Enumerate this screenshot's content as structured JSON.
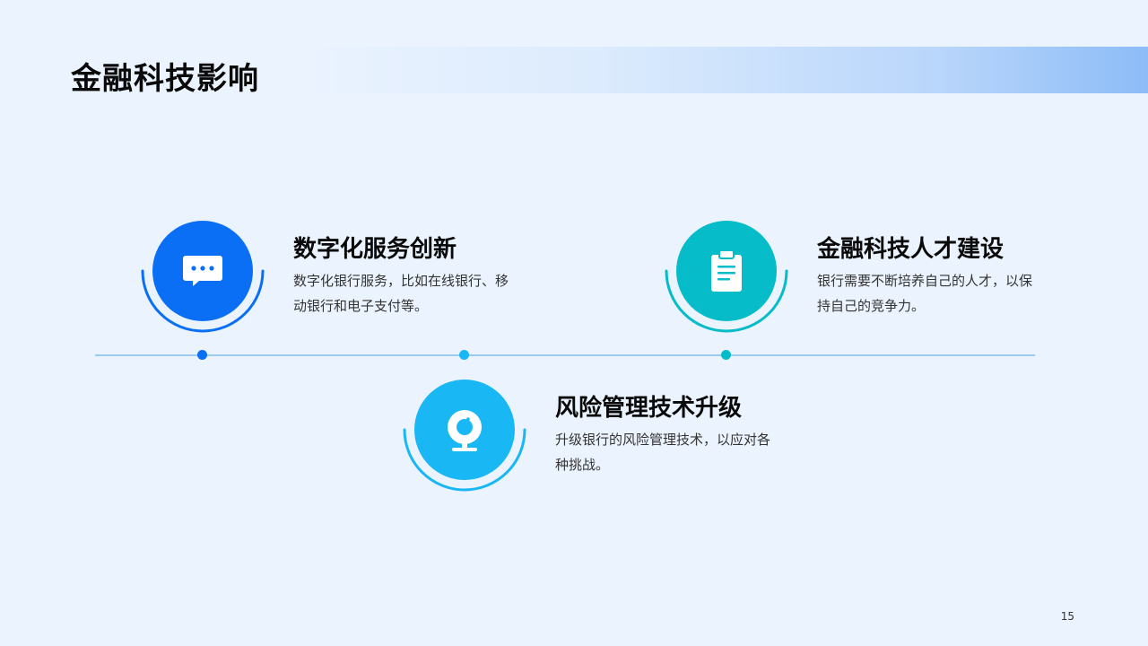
{
  "slide": {
    "title": "金融科技影响",
    "page_number": "15"
  },
  "items": [
    {
      "heading": "数字化服务创新",
      "description": "数字化银行服务，比如在线银行、移动银行和电子支付等。",
      "icon": "chat-bubble-icon",
      "color": "#0b6ff5"
    },
    {
      "heading": "风险管理技术升级",
      "description": "升级银行的风险管理技术，以应对各种挑战。",
      "icon": "webcam-icon",
      "color": "#1ab7f5"
    },
    {
      "heading": "金融科技人才建设",
      "description": "银行需要不断培养自己的人才，以保持自己的竞争力。",
      "icon": "clipboard-icon",
      "color": "#05bcc8"
    }
  ],
  "colors": {
    "background": "#eaf3fe",
    "timeline": "#9ccaf0"
  }
}
